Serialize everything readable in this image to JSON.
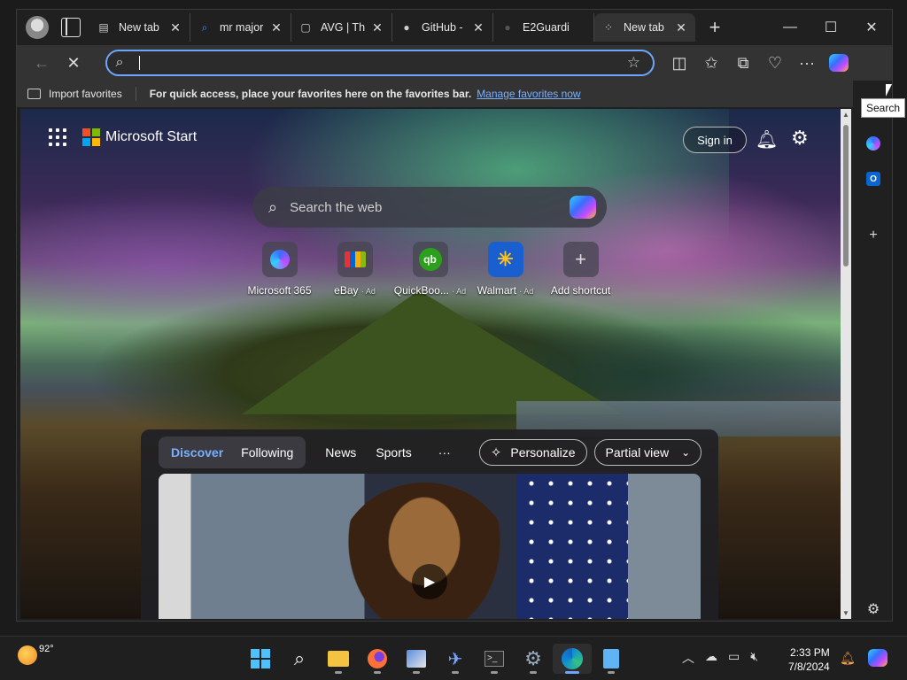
{
  "tabs": [
    {
      "title": "New tab",
      "icon": "newtab-page-icon"
    },
    {
      "title": "mr major",
      "icon": "search-icon"
    },
    {
      "title": "AVG | Th",
      "icon": "document-icon"
    },
    {
      "title": "GitHub -",
      "icon": "github-icon"
    },
    {
      "title": "E2Guardi",
      "icon": "github-icon"
    },
    {
      "title": "New tab",
      "icon": "loading-icon",
      "active": true
    }
  ],
  "address_bar": {
    "value": "",
    "placeholder": ""
  },
  "favorites_bar": {
    "import_label": "Import favorites",
    "message": "For quick access, place your favorites here on the favorites bar.",
    "link": "Manage favorites now"
  },
  "tooltip": "Search",
  "ms_start": {
    "brand": "Microsoft Start",
    "sign_in": "Sign in",
    "search_placeholder": "Search the web"
  },
  "shortcuts": [
    {
      "label": "Microsoft 365",
      "ad": ""
    },
    {
      "label": "eBay",
      "ad": "· Ad"
    },
    {
      "label": "QuickBoo...",
      "ad": "· Ad"
    },
    {
      "label": "Walmart",
      "ad": "· Ad"
    },
    {
      "label": "Add shortcut",
      "ad": ""
    }
  ],
  "feed": {
    "tabs": [
      "Discover",
      "Following"
    ],
    "links": [
      "News",
      "Sports"
    ],
    "more": "···",
    "personalize": "Personalize",
    "view": "Partial view"
  },
  "taskbar": {
    "temperature": "92°",
    "time": "2:33 PM",
    "date": "7/8/2024"
  },
  "colors": {
    "accent": "#6ea6ff",
    "link": "#7ab0ff",
    "toolbar": "#333333"
  }
}
